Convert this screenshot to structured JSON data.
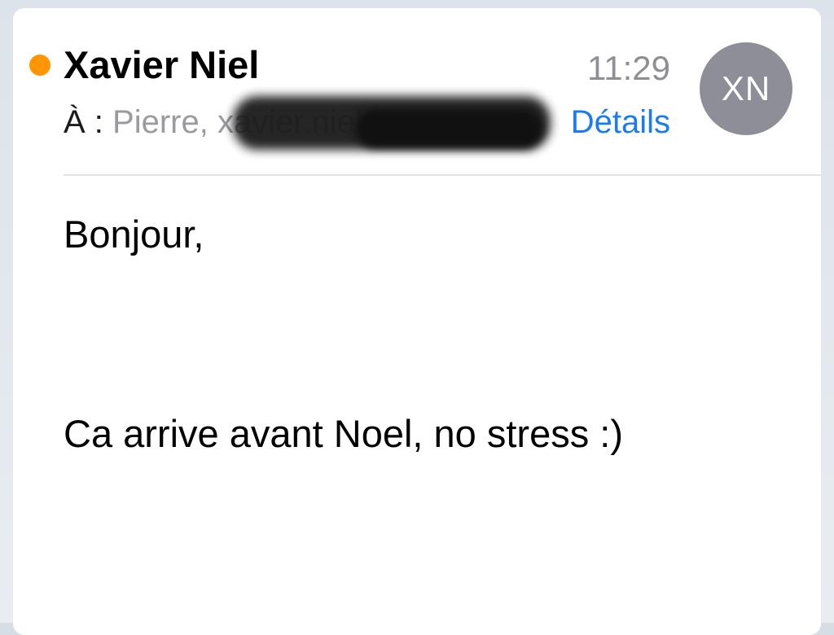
{
  "email": {
    "sender": "Xavier Niel",
    "time": "11:29",
    "to_label": "À :",
    "recipients": "Pierre, xavier.niel@free.fr",
    "details_link": "Détails",
    "avatar_initials": "XN",
    "body": {
      "greeting": "Bonjour,",
      "message": "Ca arrive avant Noel, no stress :)"
    }
  },
  "icons": {
    "unread_indicator": "unread-dot-icon"
  },
  "colors": {
    "unread_dot": "#ff9500",
    "link": "#1a7cf0",
    "avatar_bg": "#8e8e98",
    "secondary_text": "#8e8e93"
  }
}
